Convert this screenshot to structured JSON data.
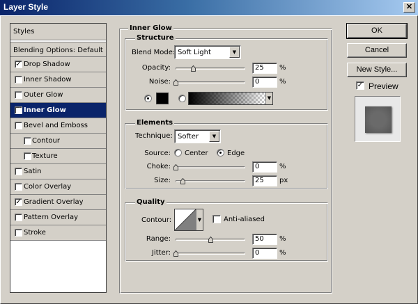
{
  "window": {
    "title": "Layer Style",
    "close_glyph": "✕"
  },
  "styles_list": {
    "header": "Styles",
    "blending": "Blending Options: Default",
    "items": [
      {
        "label": "Drop Shadow",
        "checked": true,
        "selected": false,
        "sub": false
      },
      {
        "label": "Inner Shadow",
        "checked": false,
        "selected": false,
        "sub": false
      },
      {
        "label": "Outer Glow",
        "checked": false,
        "selected": false,
        "sub": false
      },
      {
        "label": "Inner Glow",
        "checked": true,
        "selected": true,
        "sub": false
      },
      {
        "label": "Bevel and Emboss",
        "checked": false,
        "selected": false,
        "sub": false
      },
      {
        "label": "Contour",
        "checked": false,
        "selected": false,
        "sub": true
      },
      {
        "label": "Texture",
        "checked": false,
        "selected": false,
        "sub": true
      },
      {
        "label": "Satin",
        "checked": false,
        "selected": false,
        "sub": false
      },
      {
        "label": "Color Overlay",
        "checked": false,
        "selected": false,
        "sub": false
      },
      {
        "label": "Gradient Overlay",
        "checked": true,
        "selected": false,
        "sub": false
      },
      {
        "label": "Pattern Overlay",
        "checked": false,
        "selected": false,
        "sub": false
      },
      {
        "label": "Stroke",
        "checked": false,
        "selected": false,
        "sub": false
      }
    ]
  },
  "inner_glow": {
    "title": "Inner Glow",
    "structure": {
      "title": "Structure",
      "blend_mode_label": "Blend Mode:",
      "blend_mode_value": "Soft Light",
      "opacity_label": "Opacity:",
      "opacity_value": "25",
      "opacity_pct": 25,
      "noise_label": "Noise:",
      "noise_value": "0",
      "noise_pct": 0,
      "unit": "%",
      "color": "#000000"
    },
    "elements": {
      "title": "Elements",
      "technique_label": "Technique:",
      "technique_value": "Softer",
      "source_label": "Source:",
      "source_center": "Center",
      "source_edge": "Edge",
      "choke_label": "Choke:",
      "choke_value": "0",
      "choke_pct": 0,
      "size_label": "Size:",
      "size_value": "25",
      "size_pct": 10,
      "pct_unit": "%",
      "px_unit": "px"
    },
    "quality": {
      "title": "Quality",
      "contour_label": "Contour:",
      "anti_aliased_label": "Anti-aliased",
      "range_label": "Range:",
      "range_value": "50",
      "range_pct": 50,
      "jitter_label": "Jitter:",
      "jitter_value": "0",
      "jitter_pct": 0,
      "unit": "%"
    }
  },
  "buttons": {
    "ok": "OK",
    "cancel": "Cancel",
    "new_style": "New Style...",
    "preview_label": "Preview",
    "preview_checked": true
  },
  "colors": {
    "selection": "#0a246a",
    "dialog_bg": "#d4d0c8"
  }
}
